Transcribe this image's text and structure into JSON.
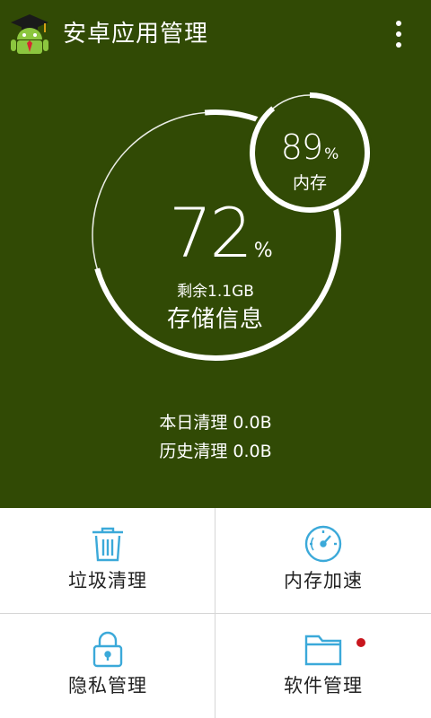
{
  "app_bar": {
    "title": "安卓应用管理",
    "logo_icon": "android-mascot-logo",
    "overflow_icon": "more-vert-icon"
  },
  "storage": {
    "percent": "72",
    "percent_sign": "%",
    "percent_value": 72,
    "remaining": "剩余1.1GB",
    "label": "存储信息"
  },
  "memory": {
    "percent": "89",
    "percent_sign": "%",
    "percent_value": 89,
    "label": "内存"
  },
  "clean_stats": {
    "today": "本日清理 0.0B",
    "history": "历史清理 0.0B"
  },
  "tiles": [
    {
      "label": "垃圾清理",
      "icon": "trash-can-icon"
    },
    {
      "label": "内存加速",
      "icon": "speedometer-icon"
    },
    {
      "label": "隐私管理",
      "icon": "padlock-icon"
    },
    {
      "label": "软件管理",
      "icon": "folder-icon",
      "has_badge": true
    }
  ],
  "colors": {
    "header_bg": "#314a05",
    "icon_accent": "#3ba9d9",
    "badge": "#c8161d",
    "ring": "#ffffff"
  }
}
